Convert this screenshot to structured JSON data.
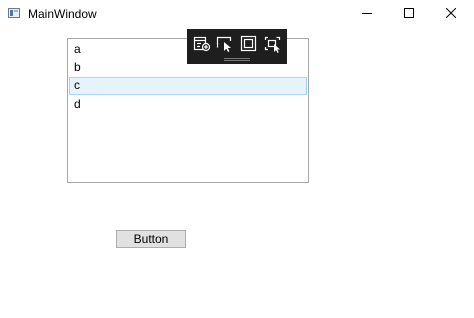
{
  "window": {
    "title": "MainWindow"
  },
  "listbox": {
    "items": [
      {
        "label": "a"
      },
      {
        "label": "b"
      },
      {
        "label": "c",
        "selected": true
      },
      {
        "label": "d"
      }
    ]
  },
  "button": {
    "label": "Button"
  },
  "toolbar": {
    "icons": [
      "live-visual-tree-icon",
      "select-element-icon",
      "display-layout-adorners-icon",
      "track-focused-element-icon"
    ]
  },
  "colors": {
    "selection_background": "#e5f3fb",
    "selection_border": "#a7d6f4",
    "toolbar_background": "#1e1e1e",
    "button_background": "#e1e1e1"
  }
}
